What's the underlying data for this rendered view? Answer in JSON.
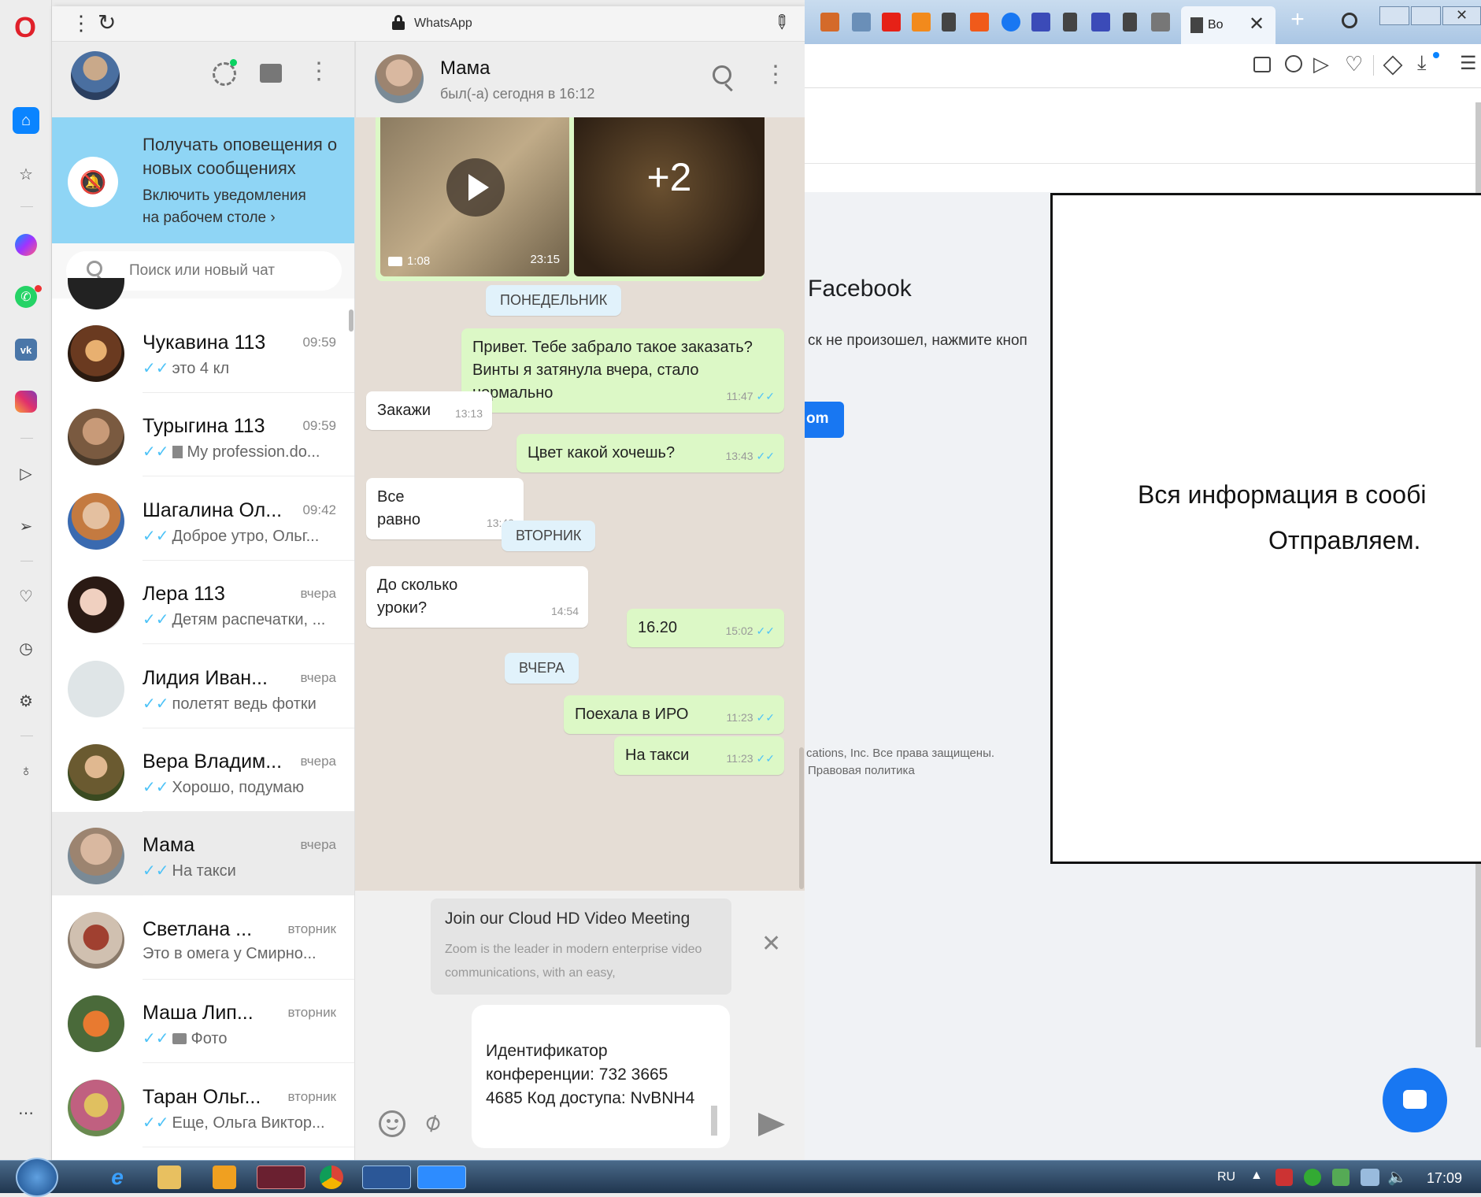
{
  "opera": {
    "logo": "O",
    "more": "⋯"
  },
  "wa_topbar": {
    "title": "WhatsApp"
  },
  "notify_banner": {
    "title": "Получать оповещения о новых сообщениях",
    "link": "Включить уведомления на рабочем столе ›"
  },
  "search": {
    "placeholder": "Поиск или новый чат"
  },
  "chats": [
    {
      "name": "Чукавина 113",
      "time": "09:59",
      "preview": "это 4 кл",
      "tick": "✓✓"
    },
    {
      "name": "Турыгина 113",
      "time": "09:59",
      "preview": "My profession.do...",
      "tick": "✓✓",
      "doc": true
    },
    {
      "name": "Шагалина Ол...",
      "time": "09:42",
      "preview": "Доброе утро, Ольг...",
      "tick": "✓✓"
    },
    {
      "name": "Лера 113",
      "time": "вчера",
      "preview": "Детям распечатки, ...",
      "tick": "✓✓"
    },
    {
      "name": "Лидия Иван...",
      "time": "вчера",
      "preview": "полетят ведь фотки",
      "tick": "✓✓"
    },
    {
      "name": "Вера Владим...",
      "time": "вчера",
      "preview": "Хорошо, подумаю",
      "tick": "✓✓"
    },
    {
      "name": "Мама",
      "time": "вчера",
      "preview": "На такси",
      "tick": "✓✓",
      "active": true
    },
    {
      "name": "Светлана ...",
      "time": "вторник",
      "preview": "Это в омега у Смирно...",
      "tick": ""
    },
    {
      "name": "Маша Лип...",
      "time": "вторник",
      "preview": "Фото",
      "tick": "✓✓",
      "photo": true
    },
    {
      "name": "Таран Ольг...",
      "time": "вторник",
      "preview": "Еще, Ольга Виктор...",
      "tick": "✓✓"
    }
  ],
  "conversation": {
    "name": "Мама",
    "status": "был(-а) сегодня в 16:12",
    "video_duration": "1:08",
    "video_time": "23:15",
    "more_count": "+2"
  },
  "messages": [
    {
      "type": "day",
      "text": "ПОНЕДЕЛЬНИК"
    },
    {
      "type": "out",
      "text": "Привет. Тебе забрало такое заказать? Винты я затянула вчера, стало нормально",
      "time": "11:47"
    },
    {
      "type": "in",
      "text": "Закажи",
      "time": "13:13"
    },
    {
      "type": "out",
      "text": "Цвет какой хочешь?",
      "time": "13:43"
    },
    {
      "type": "in",
      "text": "Все равно",
      "time": "13:49"
    },
    {
      "type": "day",
      "text": "ВТОРНИК"
    },
    {
      "type": "in",
      "text": "До сколько уроки?",
      "time": "14:54"
    },
    {
      "type": "out",
      "text": "16.20",
      "time": "15:02"
    },
    {
      "type": "day",
      "text": "ВЧЕРА"
    },
    {
      "type": "out",
      "text": "Поехала в ИРО",
      "time": "11:23"
    },
    {
      "type": "out",
      "text": "На такси",
      "time": "11:23"
    }
  ],
  "link_preview": {
    "title": "Join our Cloud HD Video Meeting",
    "description": "Zoom is the leader in modern enterprise video communications, with an easy,"
  },
  "composer": {
    "text": "Идентификатор конференции: 732 3665 4685 Код доступа: NvBNH4"
  },
  "browser": {
    "tab_label": "Bo",
    "facebook_title": "Facebook",
    "facebook_text": "ск не произошел, нажмите кноп",
    "facebook_button": "om",
    "footer_line1": "cations, Inc. Все права защищены.",
    "footer_line2": "Правовая политика"
  },
  "popup": {
    "line1": "Вся информация в сообі",
    "line2": "Отправляем."
  },
  "taskbar": {
    "lang": "RU",
    "clock": "17:09"
  }
}
